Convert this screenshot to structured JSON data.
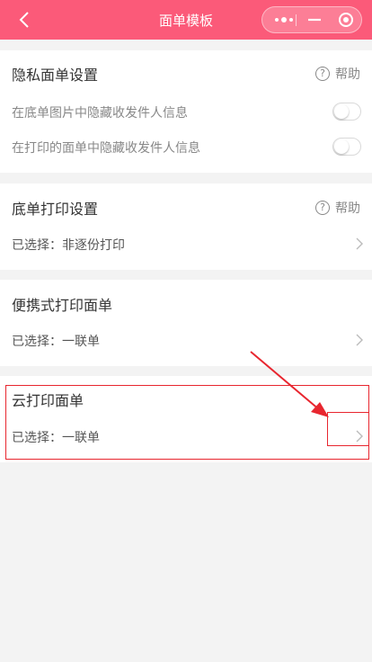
{
  "nav": {
    "title": "面单模板"
  },
  "privacy": {
    "title": "隐私面单设置",
    "help_label": "帮助",
    "help_icon_text": "?",
    "options": [
      {
        "label": "在底单图片中隐藏收发件人信息",
        "enabled": false
      },
      {
        "label": "在打印的面单中隐藏收发件人信息",
        "enabled": false
      }
    ]
  },
  "bottom_print": {
    "title": "底单打印设置",
    "help_label": "帮助",
    "help_icon_text": "?",
    "selection": "已选择：非逐份打印"
  },
  "portable_print": {
    "title": "便携式打印面单",
    "selection": "已选择：一联单"
  },
  "cloud_print": {
    "title": "云打印面单",
    "selection": "已选择：一联单"
  },
  "colors": {
    "navbar": "#fb5a79",
    "highlight": "#e8262f"
  }
}
